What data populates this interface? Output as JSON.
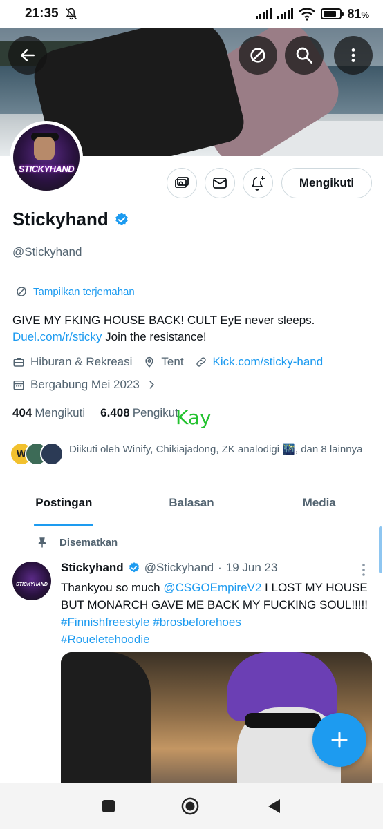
{
  "status_bar": {
    "time": "21:35",
    "battery": "81",
    "battery_unit": "%",
    "battery_level": 0.81
  },
  "banner_buttons": [
    "back-arrow-icon",
    "translate-icon",
    "search-icon",
    "more-vertical-icon"
  ],
  "profile": {
    "name": "Stickyhand",
    "handle": "@Stickyhand",
    "avatar_text": "STICKYHAND",
    "follow_button": "Mengikuti",
    "translate_label": "Tampilkan terjemahan",
    "bio_line1": "GIVE MY FKING HOUSE BACK! CULT EyE never sleeps.",
    "bio_link": "Duel.com/r/sticky",
    "bio_line2_rest": " Join the resistance!",
    "category": "Hiburan & Rekreasi",
    "location": "Tent",
    "website": "Kick.com/sticky-hand",
    "joined": "Bergabung Mei 2023",
    "following_count": "404",
    "following_label": "Mengikuti",
    "followers_count": "6.408",
    "followers_label": "Pengikut",
    "overlay_text": "Kay",
    "followed_by": "Diikuti oleh Winify, Chikiajadong, ZK analodigi 🌃, dan 8 lainnya",
    "follower_avatar_letter": "W"
  },
  "tabs": [
    "Postingan",
    "Balasan",
    "Media"
  ],
  "post": {
    "pinned_label": "Disematkan",
    "author_name": "Stickyhand",
    "author_handle": "@Stickyhand",
    "separator": "·",
    "date": "19 Jun 23",
    "text_1": "Thankyou so much ",
    "mention": "@CSGOEmpireV2",
    "text_2": " I LOST MY HOUSE BUT MONARCH GAVE ME BACK MY FUCKING SOUL!!!!! ",
    "hashtag_1": "#Finnishfreestyle",
    "hashtag_2": "#brosbeforehoes",
    "hashtag_3": "#Roueletehoodie",
    "avatar_text": "STICKYHAND"
  },
  "colors": {
    "accent": "#1d9bf0",
    "text": "#0f1419",
    "muted": "#536471",
    "border": "#cfd9de",
    "overlay_green": "#22c22e"
  }
}
